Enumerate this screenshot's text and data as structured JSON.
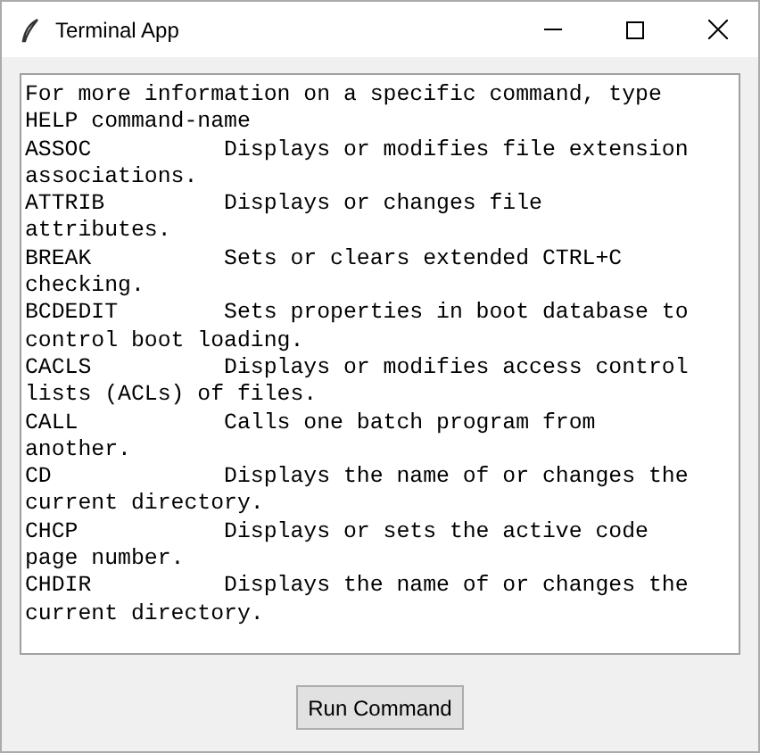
{
  "window": {
    "title": "Terminal App"
  },
  "output": {
    "lines": [
      "For more information on a specific command, type",
      "HELP command-name",
      "ASSOC          Displays or modifies file extension",
      "associations.",
      "ATTRIB         Displays or changes file",
      "attributes.",
      "BREAK          Sets or clears extended CTRL+C",
      "checking.",
      "BCDEDIT        Sets properties in boot database to",
      "control boot loading.",
      "CACLS          Displays or modifies access control",
      "lists (ACLs) of files.",
      "CALL           Calls one batch program from",
      "another.",
      "CD             Displays the name of or changes the",
      "current directory.",
      "CHCP           Displays or sets the active code",
      "page number.",
      "CHDIR          Displays the name of or changes the",
      "current directory."
    ]
  },
  "buttons": [
    "Run Command"
  ]
}
